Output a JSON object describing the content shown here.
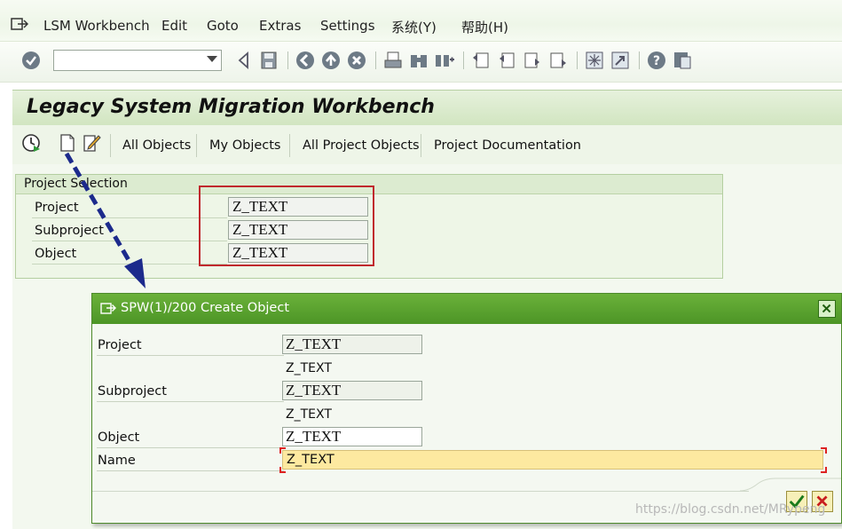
{
  "menubar": {
    "items": [
      "LSM Workbench",
      "Edit",
      "Goto",
      "Extras",
      "Settings",
      "系统(Y)",
      "帮助(H)"
    ]
  },
  "toolbar": {
    "command_value": "",
    "icons": [
      "enter-icon",
      "back-icon",
      "save-icon",
      "back-nav-icon",
      "exit-icon",
      "cancel-icon",
      "print-icon",
      "find-icon",
      "find-next-icon",
      "first-page-icon",
      "previous-page-icon",
      "next-page-icon",
      "last-page-icon",
      "create-session-icon",
      "shortcut-icon",
      "help-icon",
      "layout-icon"
    ]
  },
  "page": {
    "title": "Legacy System Migration Workbench"
  },
  "app_toolbar": {
    "buttons": [
      "All Objects",
      "My Objects",
      "All Project Objects",
      "Project Documentation"
    ]
  },
  "project_selection": {
    "header": "Project Selection",
    "fields": [
      {
        "label": "Project",
        "value": "Z_TEXT"
      },
      {
        "label": "Subproject",
        "value": "Z_TEXT"
      },
      {
        "label": "Object",
        "value": "Z_TEXT"
      }
    ]
  },
  "dialog": {
    "title": "SPW(1)/200 Create Object",
    "project_label": "Project",
    "project_value": "Z_TEXT",
    "project_desc": "Z_TEXT",
    "subproject_label": "Subproject",
    "subproject_value": "Z_TEXT",
    "subproject_desc": "Z_TEXT",
    "object_label": "Object",
    "object_value": "Z_TEXT",
    "name_label": "Name",
    "name_value": "Z_TEXT"
  },
  "watermark": "https://blog.csdn.net/MRypeng",
  "colors": {
    "dialog_title": "#4c9526",
    "highlight_box": "#c0282d",
    "arrow": "#1c2a8c",
    "name_field": "#fde9a0"
  }
}
